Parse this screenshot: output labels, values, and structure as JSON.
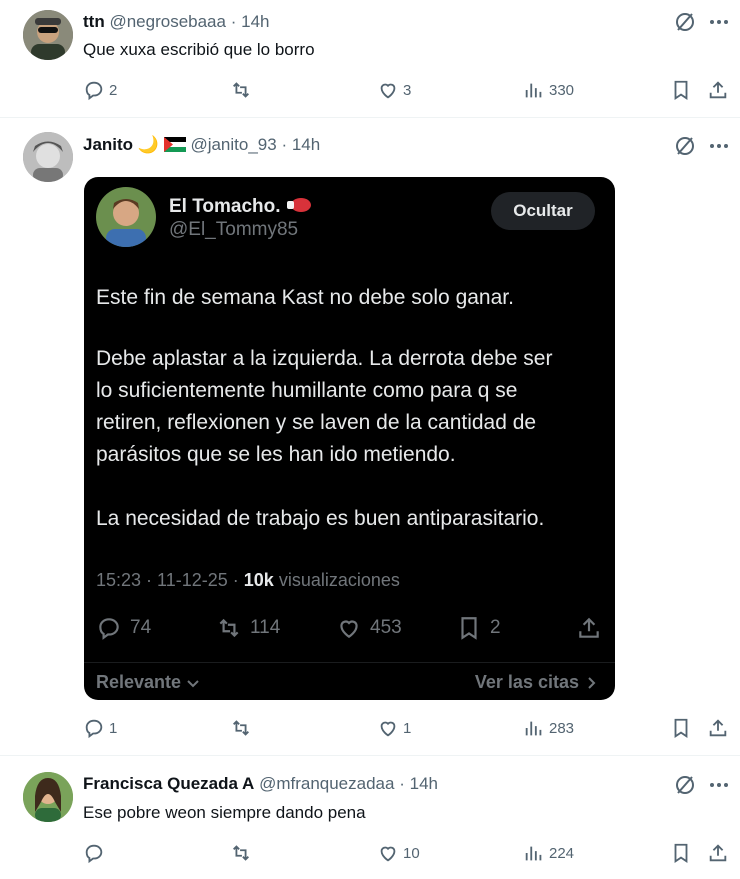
{
  "posts": [
    {
      "name": "ttn",
      "handle": "@negrosebaaa",
      "time": "14h",
      "text": "Que xuxa escribió que lo borro",
      "replies": "2",
      "reposts": "",
      "likes": "3",
      "views": "330"
    },
    {
      "name": "Janito",
      "handle": "@janito_93",
      "time": "14h",
      "text": "",
      "replies": "1",
      "reposts": "",
      "likes": "1",
      "views": "283"
    },
    {
      "name": "Francisca Quezada A",
      "handle": "@mfranquezadaa",
      "time": "14h",
      "text": "Ese pobre weon siempre dando pena",
      "replies": "",
      "reposts": "",
      "likes": "10",
      "views": "224"
    }
  ],
  "quoted": {
    "name": "El Tomacho.",
    "handle": "@El_Tommy85",
    "hide_label": "Ocultar",
    "paragraphs": [
      [
        "Este fin de semana Kast no debe solo ganar."
      ],
      [
        "Debe aplastar a la izquierda. La derrota debe ser",
        "lo suficientemente humillante como para q se",
        "retiren, reflexionen y se laven de la cantidad de",
        "parásitos que se les han ido metiendo."
      ],
      [
        "La necesidad de trabajo es buen antiparasitario."
      ]
    ],
    "time": "15:23 · 11-12-25 ·",
    "views_count": "10k",
    "views_label": "visualizaciones",
    "replies": "74",
    "reposts": "114",
    "likes": "453",
    "bookmarks": "2",
    "relevante_label": "Relevante",
    "citas_label": "Ver las citas"
  },
  "colors": {
    "accent_muted": "#536471",
    "text": "#0f1419",
    "card_bg": "#000000"
  },
  "icons": [
    "reply-icon",
    "repost-icon",
    "like-icon",
    "views-icon",
    "bookmark-icon",
    "share-icon",
    "grok-icon",
    "more-icon",
    "boxing-glove-icon",
    "moon-icon",
    "palestine-flag-icon"
  ]
}
